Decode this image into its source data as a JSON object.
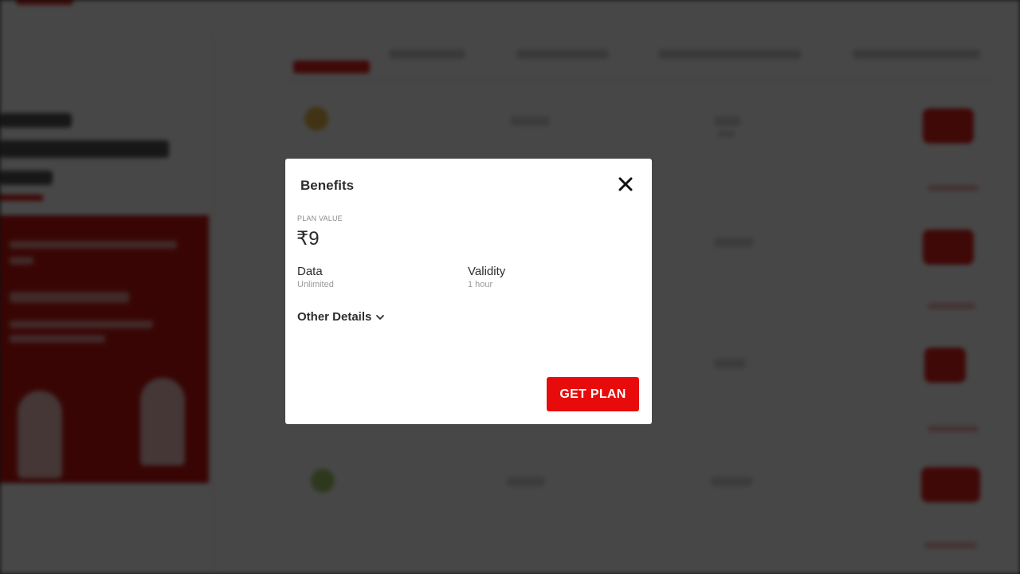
{
  "modal": {
    "title": "Benefits",
    "plan_value_label": "PLAN VALUE",
    "plan_value": "₹9",
    "benefits": [
      {
        "label": "Data",
        "value": "Unlimited"
      },
      {
        "label": "Validity",
        "value": "1 hour"
      }
    ],
    "other_details_label": "Other Details",
    "get_plan_label": "GET PLAN"
  },
  "icons": {
    "close": "close-icon",
    "expand": "chevron-down-icon"
  },
  "colors": {
    "accent": "#e80b0b",
    "overlay": "#3a3a3a",
    "modal_bg": "#ffffff"
  }
}
